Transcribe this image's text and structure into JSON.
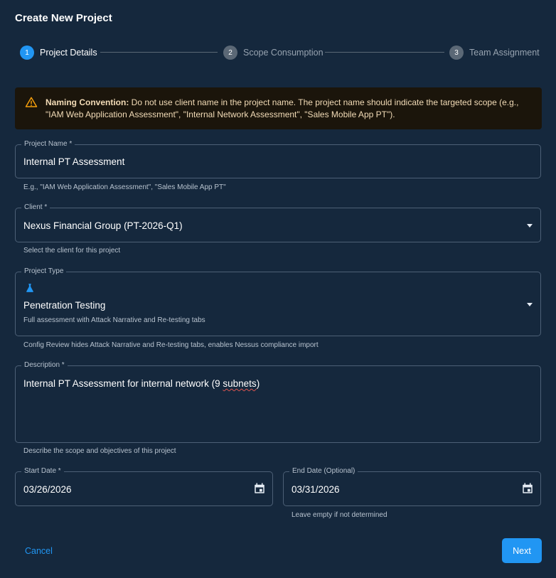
{
  "dialog": {
    "title": "Create New Project"
  },
  "stepper": {
    "steps": [
      {
        "number": "1",
        "label": "Project Details",
        "active": true
      },
      {
        "number": "2",
        "label": "Scope Consumption",
        "active": false
      },
      {
        "number": "3",
        "label": "Team Assignment",
        "active": false
      }
    ]
  },
  "alert": {
    "icon": "warning-triangle-icon",
    "heading": "Naming Convention:",
    "text": " Do not use client name in the project name. The project name should indicate the targeted scope (e.g., \"IAM Web Application Assessment\", \"Internal Network Assessment\", \"Sales Mobile App PT\").",
    "color": "#f59e0b"
  },
  "form": {
    "project_name": {
      "label": "Project Name *",
      "value": "Internal PT Assessment",
      "helper": "E.g., \"IAM Web Application Assessment\", \"Sales Mobile App PT\""
    },
    "client": {
      "label": "Client *",
      "value": "Nexus Financial Group (PT-2026-Q1)",
      "helper": "Select the client for this project"
    },
    "project_type": {
      "label": "Project Type",
      "icon": "flask-icon",
      "value": "Penetration Testing",
      "sub": "Full assessment with Attack Narrative and Re-testing tabs",
      "helper": "Config Review hides Attack Narrative and Re-testing tabs, enables Nessus compliance import"
    },
    "description": {
      "label": "Description *",
      "value_prefix": "Internal PT Assessment for internal network (9 ",
      "value_misspelled": "subnets",
      "value_suffix": ")",
      "helper": "Describe the scope and objectives of this project"
    },
    "start_date": {
      "label": "Start Date *",
      "value": "03/26/2026"
    },
    "end_date": {
      "label": "End Date (Optional)",
      "value": "03/31/2026",
      "helper": "Leave empty if not determined"
    }
  },
  "actions": {
    "cancel_label": "Cancel",
    "next_label": "Next"
  },
  "colors": {
    "accent": "#2196f3",
    "background": "#15283d",
    "border": "#4d6076",
    "warning": "#f59e0b"
  }
}
